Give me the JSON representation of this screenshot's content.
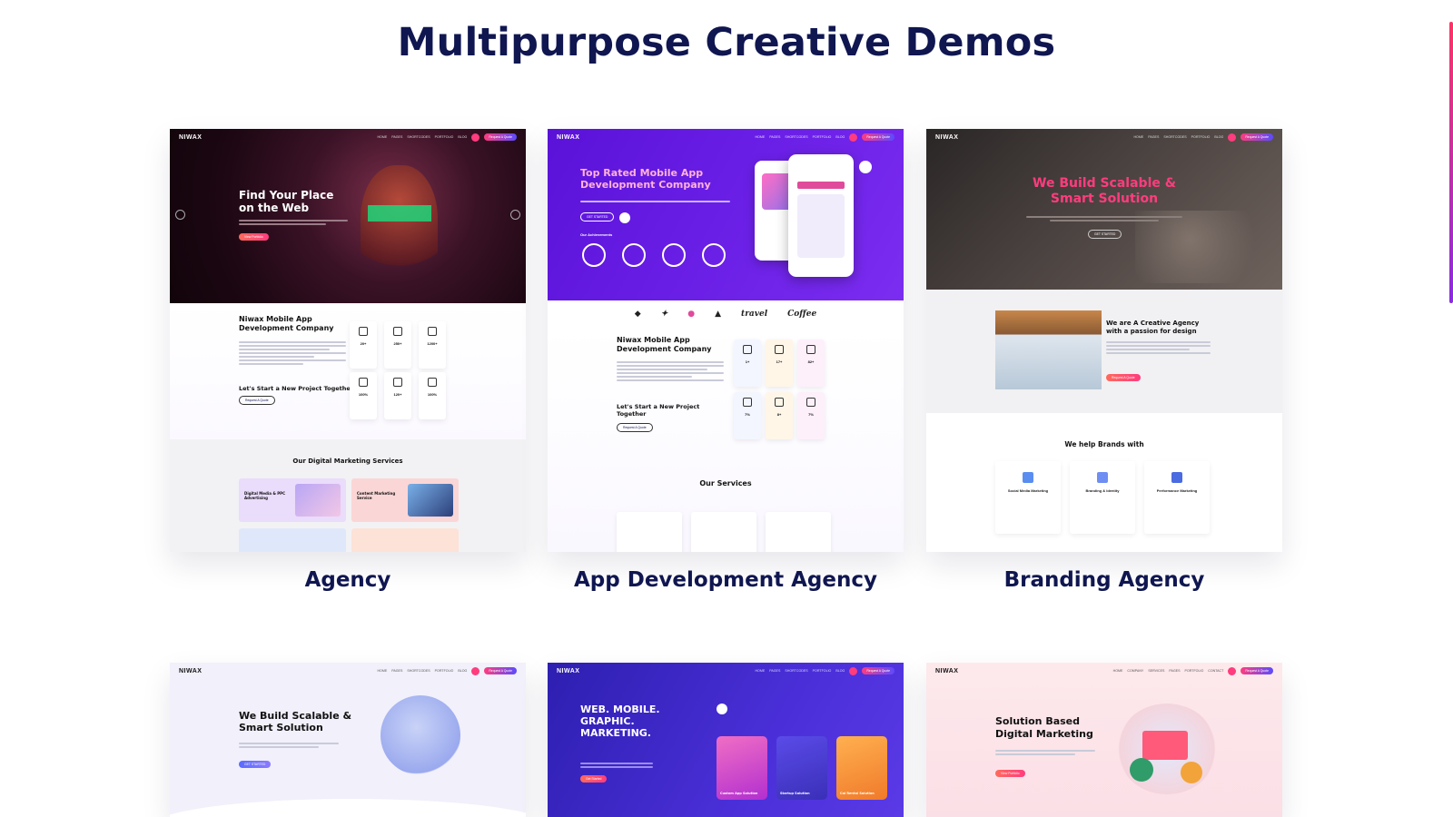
{
  "page": {
    "title": "Multipurpose Creative Demos"
  },
  "demos": [
    {
      "label": "Agency",
      "thumb": {
        "logo": "NIWAX",
        "hero_title": "Find Your Place on the Web",
        "section_title_1": "Niwax Mobile App Development Company",
        "stats": [
          "20+",
          "250+",
          "1200+",
          "100%",
          "120+",
          "100%"
        ],
        "cta_title": "Let's Start a New Project Together",
        "services_title": "Our Digital Marketing Services",
        "svc_1": "Digital Media & PPC Advertising",
        "svc_2": "Content Marketing Service"
      }
    },
    {
      "label": "App Development Agency",
      "thumb": {
        "logo": "NIWAX",
        "hero_title": "Top Rated Mobile App Development Company",
        "achievements": "Our Achievements",
        "section_title_1": "Niwax Mobile App Development Company",
        "stats": [
          "1+",
          "17+",
          "82+",
          "7%",
          "8+",
          "7%"
        ],
        "cta_title": "Let's Start a New Project Together",
        "services_title": "Our Services",
        "brands": [
          "travel",
          "Coffee"
        ]
      }
    },
    {
      "label": "Branding Agency",
      "thumb": {
        "logo": "NIWAX",
        "hero_title": "We Build Scalable & Smart Solution",
        "about_title": "We are A Creative Agency with a passion for design",
        "help_title": "We help Brands with",
        "services": [
          "Social Media Marketing",
          "Branding & Identity",
          "Performance Marketing"
        ]
      }
    },
    {
      "label": "",
      "thumb": {
        "logo": "NIWAX",
        "hero_title": "We Build Scalable & Smart Solution"
      }
    },
    {
      "label": "",
      "thumb": {
        "logo": "NIWAX",
        "hero_title": "WEB. MOBILE. GRAPHIC. MARKETING.",
        "tiles": [
          "Custom App Solution",
          "Startup Solution",
          "Cal Rental Solution"
        ]
      }
    },
    {
      "label": "",
      "thumb": {
        "logo": "NIWAX",
        "hero_title": "Solution Based Digital Marketing"
      }
    }
  ],
  "colors": {
    "title": "#0f1650",
    "accent_pink": "#ff3c7e",
    "accent_purple": "#5a1fe0"
  }
}
